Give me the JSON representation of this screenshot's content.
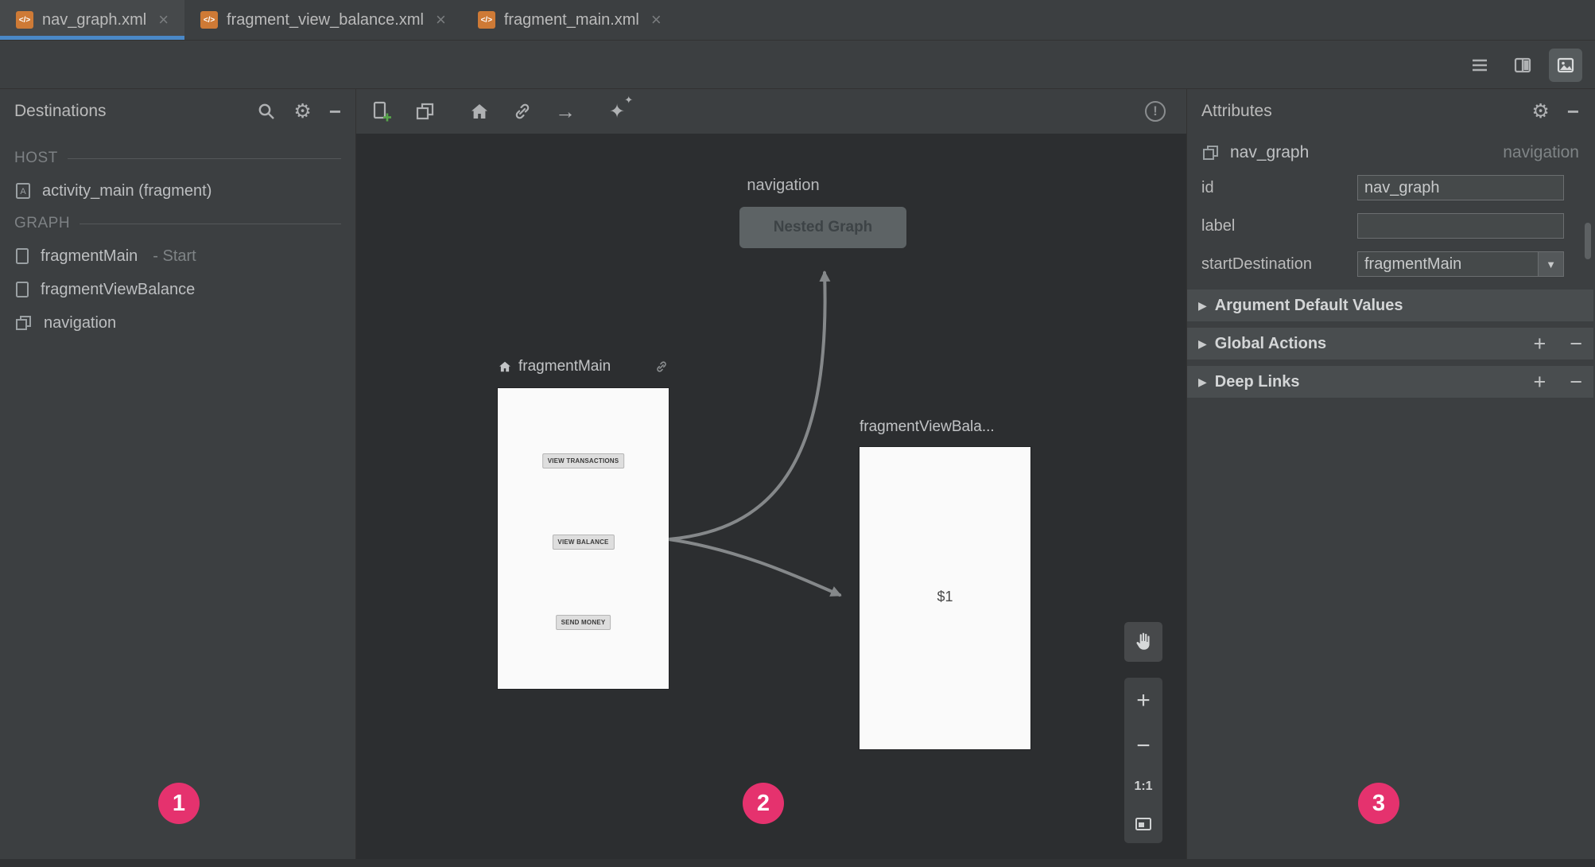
{
  "icons": {
    "close": "×",
    "gear": "⚙",
    "minus_sign": "−",
    "plus": "+",
    "collapse": "▶",
    "dropdown": "▼",
    "warning": "!",
    "arrow_action": "→",
    "sparkle": "✦",
    "xml_tag": "</>"
  },
  "colors": {
    "panel_bg": "#3c3f41",
    "canvas_bg": "#2c2e30",
    "active_tab_underline": "#4a88c7",
    "annotation_badge": "#e5326e",
    "xml_file_icon": "#ce7a36"
  },
  "tabs": [
    {
      "label": "nav_graph.xml",
      "active": true
    },
    {
      "label": "fragment_view_balance.xml",
      "active": false
    },
    {
      "label": "fragment_main.xml",
      "active": false
    }
  ],
  "destinations": {
    "title": "Destinations",
    "host_label": "HOST",
    "host_item": "activity_main (fragment)",
    "graph_label": "GRAPH",
    "graph_items": [
      {
        "name": "fragmentMain",
        "suffix": "- Start"
      },
      {
        "name": "fragmentViewBalance",
        "suffix": ""
      },
      {
        "name": "navigation",
        "suffix": ""
      }
    ]
  },
  "canvas": {
    "nested_title": "navigation",
    "nested_box_label": "Nested Graph",
    "main_title": "fragmentMain",
    "main_buttons": [
      "VIEW TRANSACTIONS",
      "VIEW BALANCE",
      "SEND MONEY"
    ],
    "balance_title": "fragmentViewBala...",
    "balance_content": "$1",
    "zoom_ratio": "1:1"
  },
  "attributes": {
    "title": "Attributes",
    "component_name": "nav_graph",
    "component_type": "navigation",
    "fields": [
      {
        "label": "id",
        "value": "nav_graph"
      },
      {
        "label": "label",
        "value": ""
      },
      {
        "label": "startDestination",
        "value": "fragmentMain"
      }
    ],
    "sections": [
      {
        "label": "Argument Default Values"
      },
      {
        "label": "Global Actions"
      },
      {
        "label": "Deep Links"
      }
    ]
  },
  "annotations": [
    "1",
    "2",
    "3"
  ]
}
